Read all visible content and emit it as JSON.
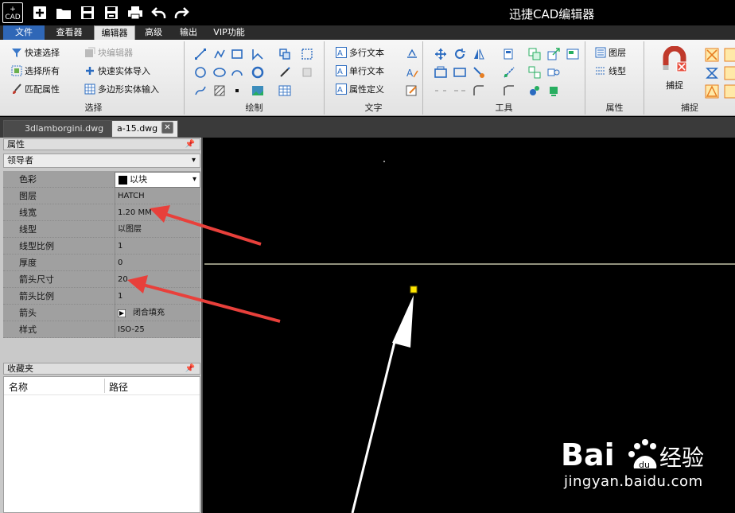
{
  "titlebar": {
    "logo_top": "+",
    "logo_bottom": "CAD",
    "app_title": "迅捷CAD编辑器",
    "quick_icons": [
      "new-icon",
      "open-folder-icon",
      "save-icon",
      "save-as-icon",
      "print-icon",
      "undo-icon",
      "redo-icon"
    ]
  },
  "menu": {
    "tabs": [
      "文件",
      "查看器",
      "编辑器",
      "高级",
      "输出",
      "VIP功能"
    ],
    "active": "编辑器"
  },
  "ribbon": {
    "select": {
      "label": "选择",
      "items": [
        "快速选择",
        "选择所有",
        "匹配属性",
        "块编辑器",
        "快速实体导入",
        "多边形实体输入"
      ]
    },
    "draw": {
      "label": "绘制"
    },
    "text": {
      "label": "文字",
      "items": [
        "多行文本",
        "单行文本",
        "属性定义"
      ]
    },
    "tools": {
      "label": "工具"
    },
    "properties": {
      "label": "属性",
      "items": [
        "图层",
        "线型"
      ]
    },
    "snap": {
      "label": "捕捉",
      "button": "捕捉"
    }
  },
  "doc_tabs": [
    {
      "name": "3dlamborgini.dwg",
      "active": false
    },
    {
      "name": "a-15.dwg",
      "active": true
    }
  ],
  "properties_panel": {
    "title": "属性",
    "entity": "领导者",
    "rows": [
      {
        "name": "色彩",
        "value": "以块"
      },
      {
        "name": "图层",
        "value": "HATCH"
      },
      {
        "name": "线宽",
        "value": "1.20 MM"
      },
      {
        "name": "线型",
        "value": "以图层"
      },
      {
        "name": "线型比例",
        "value": "1"
      },
      {
        "name": "厚度",
        "value": "0"
      },
      {
        "name": "箭头尺寸",
        "value": "20"
      },
      {
        "name": "箭头比例",
        "value": "1"
      },
      {
        "name": "箭头",
        "value": "闭合填充"
      },
      {
        "name": "样式",
        "value": "ISO-25"
      }
    ]
  },
  "favorites_panel": {
    "title": "收藏夹",
    "columns": [
      "名称",
      "路径"
    ]
  },
  "watermark": {
    "brand": "Bai du 经验",
    "url": "jingyan.baidu.com"
  },
  "colors": {
    "annotation_arrow": "#e8403b",
    "grip": "#ffe600",
    "file_tab": "#2f67b7"
  }
}
